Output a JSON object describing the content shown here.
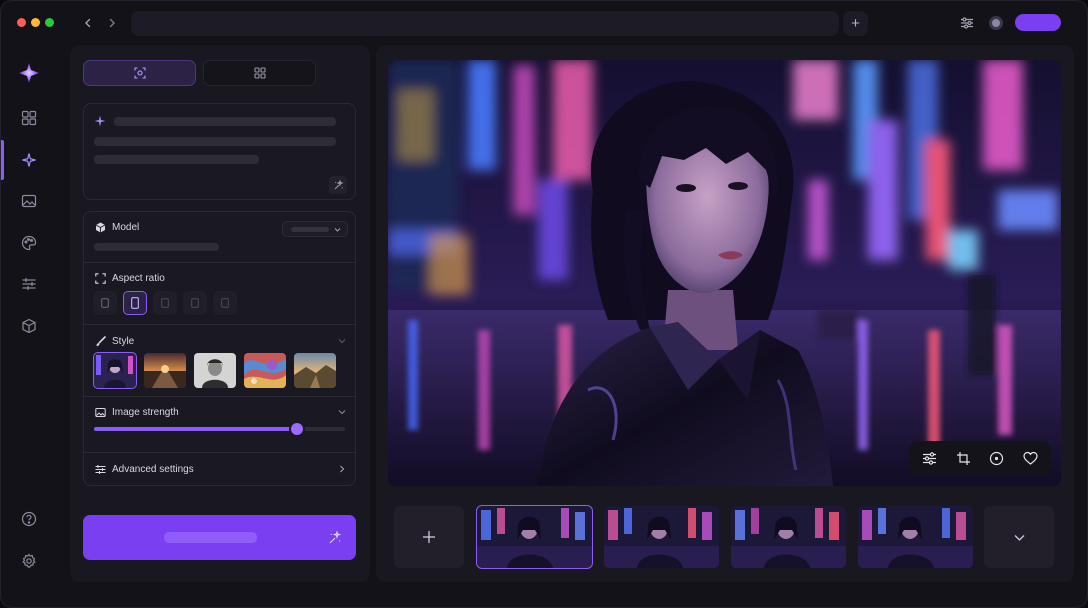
{
  "window": {
    "traffic_lights": [
      "#ff5f57",
      "#febc2e",
      "#28c840"
    ],
    "accent": "#7b3ff2"
  },
  "titlebar": {
    "back_icon": "chevron-left-icon",
    "forward_icon": "chevron-right-icon",
    "new_tab_label": "+",
    "right_icons": [
      "sliders-icon",
      "profile-icon"
    ]
  },
  "rail": {
    "items": [
      {
        "name": "logo-icon"
      },
      {
        "name": "dashboard-icon"
      },
      {
        "name": "sparkle-icon",
        "active": true
      },
      {
        "name": "image-icon"
      },
      {
        "name": "palette-icon"
      },
      {
        "name": "sliders-icon"
      },
      {
        "name": "cube-icon"
      }
    ],
    "bottom": [
      {
        "name": "help-icon"
      },
      {
        "name": "settings-icon"
      }
    ]
  },
  "panel": {
    "sections": {
      "model": {
        "label": "Model"
      },
      "aspect_ratio": {
        "label": "Aspect ratio",
        "selected_index": 1
      },
      "style": {
        "label": "Style",
        "selected_index": 0
      },
      "image_strength": {
        "label": "Image strength",
        "value": 0.81
      },
      "advanced": {
        "label": "Advanced settings"
      }
    }
  }
}
